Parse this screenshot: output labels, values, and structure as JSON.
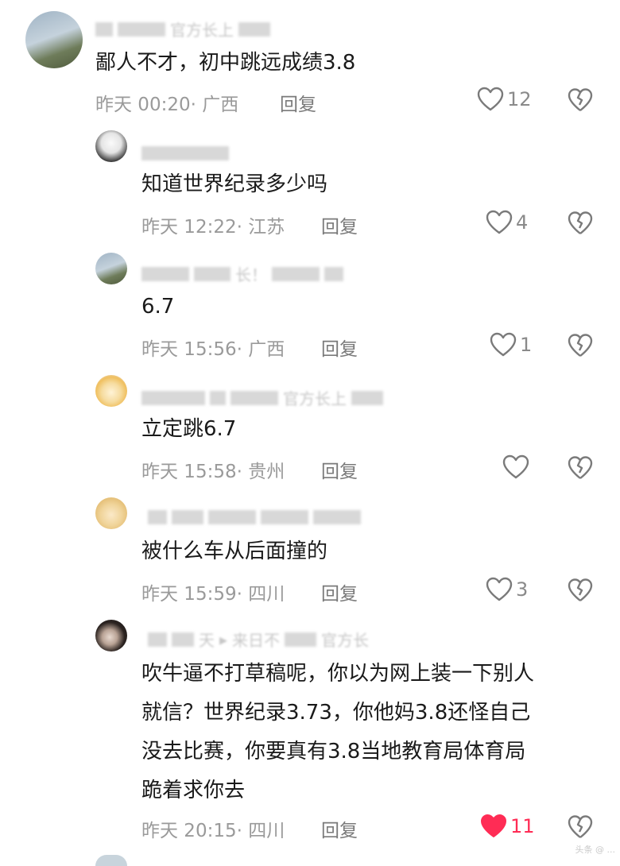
{
  "comments": [
    {
      "content": [
        "鄙人不才，初中跳远成绩3.8"
      ],
      "time": "昨天 00:20",
      "region": "· 广西",
      "reply": "回复",
      "likes": "12",
      "liked": false,
      "name_fragments": [
        "官方长上"
      ]
    },
    {
      "content": [
        "知道世界纪录多少吗"
      ],
      "time": "昨天 12:22",
      "region": "· 江苏",
      "reply": "回复",
      "likes": "4",
      "liked": false,
      "name_fragments": []
    },
    {
      "content": [
        "6.7"
      ],
      "time": "昨天 15:56",
      "region": "· 广西",
      "reply": "回复",
      "likes": "1",
      "liked": false,
      "name_fragments": [
        "长！"
      ]
    },
    {
      "content": [
        "立定跳6.7"
      ],
      "time": "昨天 15:58",
      "region": "· 贵州",
      "reply": "回复",
      "likes": "",
      "liked": false,
      "name_fragments": [
        "官方长上"
      ]
    },
    {
      "content": [
        "被什么车从后面撞的"
      ],
      "time": "昨天 15:59",
      "region": "· 四川",
      "reply": "回复",
      "likes": "3",
      "liked": false,
      "name_fragments": []
    },
    {
      "content": [
        "吹牛逼不打草稿呢，你以为网上装一下别人",
        "就信？世界纪录3.73，你他妈3.8还怪自己",
        "没去比赛，你要真有3.8当地教育局体育局",
        "跪着求你去"
      ],
      "time": "昨天 20:15",
      "region": "· 四川",
      "reply": "回复",
      "likes": "11",
      "liked": true,
      "name_fragments": [
        "天",
        "来日不",
        "官方长"
      ]
    }
  ],
  "watermark": "头条 @ ...",
  "colors": {
    "liked": "#ff2c55",
    "text": "#1a1a1a",
    "meta": "#9a9a9a"
  }
}
